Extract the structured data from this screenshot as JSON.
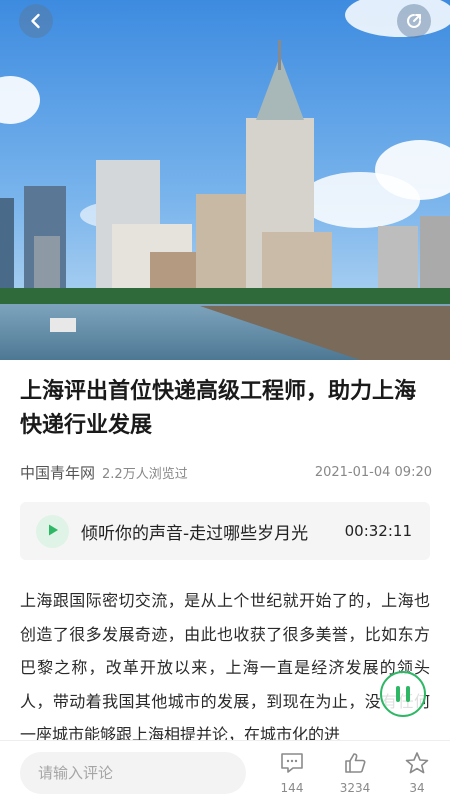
{
  "hero": {
    "image_description": "",
    "back_icon": "chevron-left-icon",
    "share_icon": "share-icon"
  },
  "article": {
    "title": "上海评出首位快递高级工程师，助力上海快递行业发展",
    "source": "中国青年网",
    "views": "2.2万人浏览过",
    "date": "2021-01-04 09:20",
    "paragraph": "上海跟国际密切交流，是从上个世纪就开始了的，上海也创造了很多发展奇迹，由此也收获了很多美誉，比如东方巴黎之称，改革开放以来，上海一直是经济发展的领头人，带动着我国其他城市的发展，到现在为止，没有任何一座城市能够跟上海相提并论，在城市化的进"
  },
  "audio": {
    "title": "倾听你的声音-走过哪些岁月光",
    "duration": "00:32:11",
    "play_icon": "play-icon",
    "accent": "#2eb866"
  },
  "floating": {
    "pause_icon": "pause-icon"
  },
  "bottom_bar": {
    "comment_placeholder": "请输入评论",
    "comments_count": "144",
    "likes_count": "3234",
    "favorites_count": "34"
  }
}
